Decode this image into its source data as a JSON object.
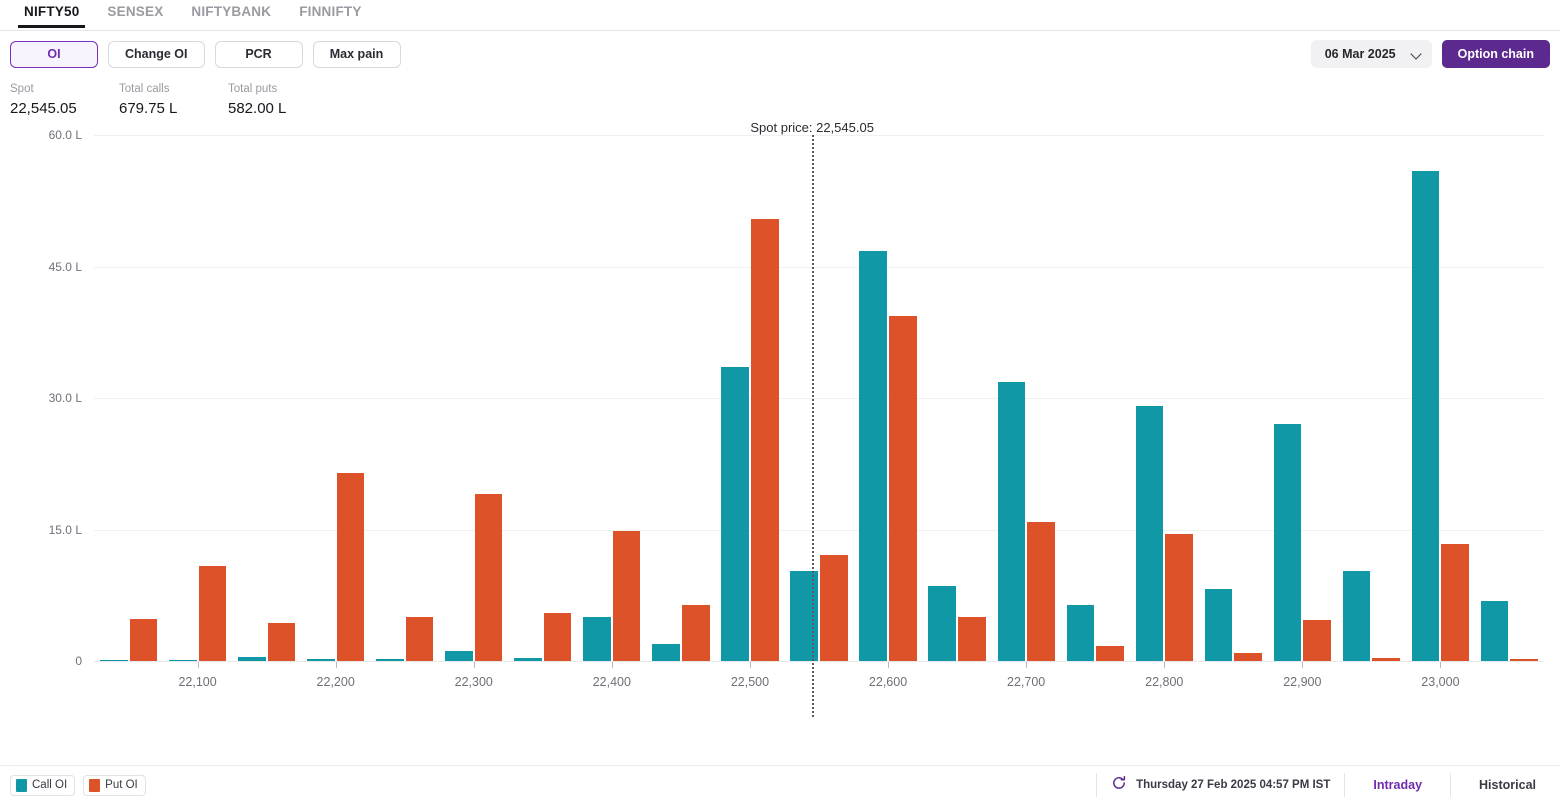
{
  "tabs": [
    {
      "label": "NIFTY50",
      "active": true
    },
    {
      "label": "SENSEX",
      "active": false
    },
    {
      "label": "NIFTYBANK",
      "active": false
    },
    {
      "label": "FINNIFTY",
      "active": false
    }
  ],
  "controls": {
    "metrics": [
      {
        "label": "OI",
        "selected": true
      },
      {
        "label": "Change OI",
        "selected": false
      },
      {
        "label": "PCR",
        "selected": false
      },
      {
        "label": "Max pain",
        "selected": false
      }
    ],
    "expiry_value": "06 Mar 2025",
    "chevron_icon": "chevron-down-icon",
    "option_chain_label": "Option chain"
  },
  "stats": [
    {
      "label": "Spot",
      "value": "22,545.05"
    },
    {
      "label": "Total calls",
      "value": "679.75 L"
    },
    {
      "label": "Total puts",
      "value": "582.00 L"
    }
  ],
  "footer": {
    "legend": [
      {
        "label": "Call OI",
        "color": "#1098a6"
      },
      {
        "label": "Put OI",
        "color": "#dd5229"
      }
    ],
    "refresh_icon": "refresh-icon",
    "timestamp": "Thursday 27 Feb 2025 04:57 PM IST",
    "views": [
      {
        "label": "Intraday",
        "active": true
      },
      {
        "label": "Historical",
        "active": false
      }
    ]
  },
  "colors": {
    "call": "#1098a6",
    "put": "#dd5229",
    "accent": "#5c2a8f",
    "accent_text": "#6f2cb0",
    "grid": "#f0f0f1",
    "axis_text": "#6f6f78"
  },
  "chart_data": {
    "type": "bar",
    "title": "",
    "xlabel": "",
    "ylabel": "",
    "grid": true,
    "legend_position": "bottom-left",
    "ylim": [
      0,
      60
    ],
    "yunit": "L",
    "ytick_labels": [
      "0",
      "15.0 L",
      "30.0 L",
      "45.0 L",
      "60.0 L"
    ],
    "ytick_values": [
      0,
      15,
      30,
      45,
      60
    ],
    "xtick_labels": [
      "22,100",
      "22,200",
      "22,300",
      "22,400",
      "22,500",
      "22,600",
      "22,700",
      "22,800",
      "22,900",
      "23,000"
    ],
    "xtick_values": [
      22100,
      22200,
      22300,
      22400,
      22500,
      22600,
      22700,
      22800,
      22900,
      23000
    ],
    "categories": [
      22050,
      22100,
      22150,
      22200,
      22250,
      22300,
      22350,
      22400,
      22450,
      22500,
      22550,
      22600,
      22650,
      22700,
      22750,
      22800,
      22850,
      22900,
      22950,
      23000,
      23050
    ],
    "series": [
      {
        "name": "Call OI",
        "color": "#1098a6",
        "values": [
          0.15,
          0.1,
          0.45,
          0.2,
          0.25,
          1.1,
          0.35,
          5.0,
          1.9,
          33.5,
          10.3,
          46.8,
          8.6,
          31.8,
          6.4,
          29.1,
          8.2,
          27.0,
          10.3,
          55.9,
          6.9
        ]
      },
      {
        "name": "Put OI",
        "color": "#dd5229",
        "values": [
          4.8,
          10.8,
          4.3,
          21.4,
          5.0,
          19.0,
          5.5,
          14.8,
          6.4,
          50.4,
          12.1,
          39.3,
          5.0,
          15.9,
          1.7,
          14.5,
          0.9,
          4.7,
          0.3,
          13.4,
          0.2
        ]
      }
    ],
    "annotation": {
      "label": "Spot price: 22,545.05",
      "x_value": 22545.05
    }
  }
}
